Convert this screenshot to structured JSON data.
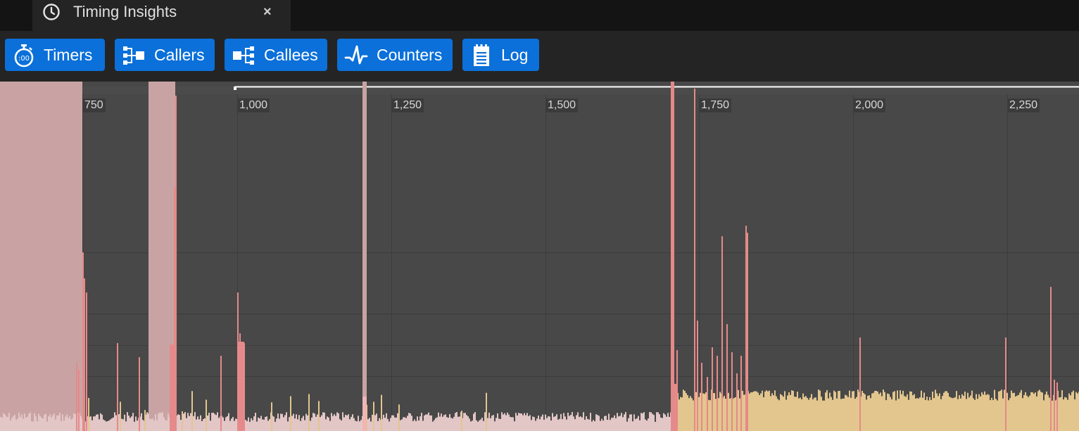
{
  "tab": {
    "title": "Timing Insights",
    "close_glyph": "×",
    "icon": "clock-icon"
  },
  "toolbar": {
    "buttons": [
      {
        "label": "Timers",
        "icon": "stopwatch-icon"
      },
      {
        "label": "Callers",
        "icon": "callers-tree-icon"
      },
      {
        "label": "Callees",
        "icon": "callees-tree-icon"
      },
      {
        "label": "Counters",
        "icon": "pulse-graph-icon"
      },
      {
        "label": "Log",
        "icon": "notepad-icon"
      }
    ],
    "accent_color": "#0b70d9"
  },
  "timeline": {
    "ruler_labels": [
      "750",
      "1,000",
      "1,250",
      "1,500",
      "1,750",
      "2,000",
      "2,250"
    ],
    "colors": {
      "background": "#484848",
      "ruler": "#4b4b4b",
      "grid": "#3c3c3c",
      "selection_shade": "#c9a3a3",
      "bar_pink": "#e3c6c6",
      "bar_yellow": "#e2c68e",
      "spike_red": "#e58a8a",
      "spike_light": "#f0b5b5"
    }
  }
}
